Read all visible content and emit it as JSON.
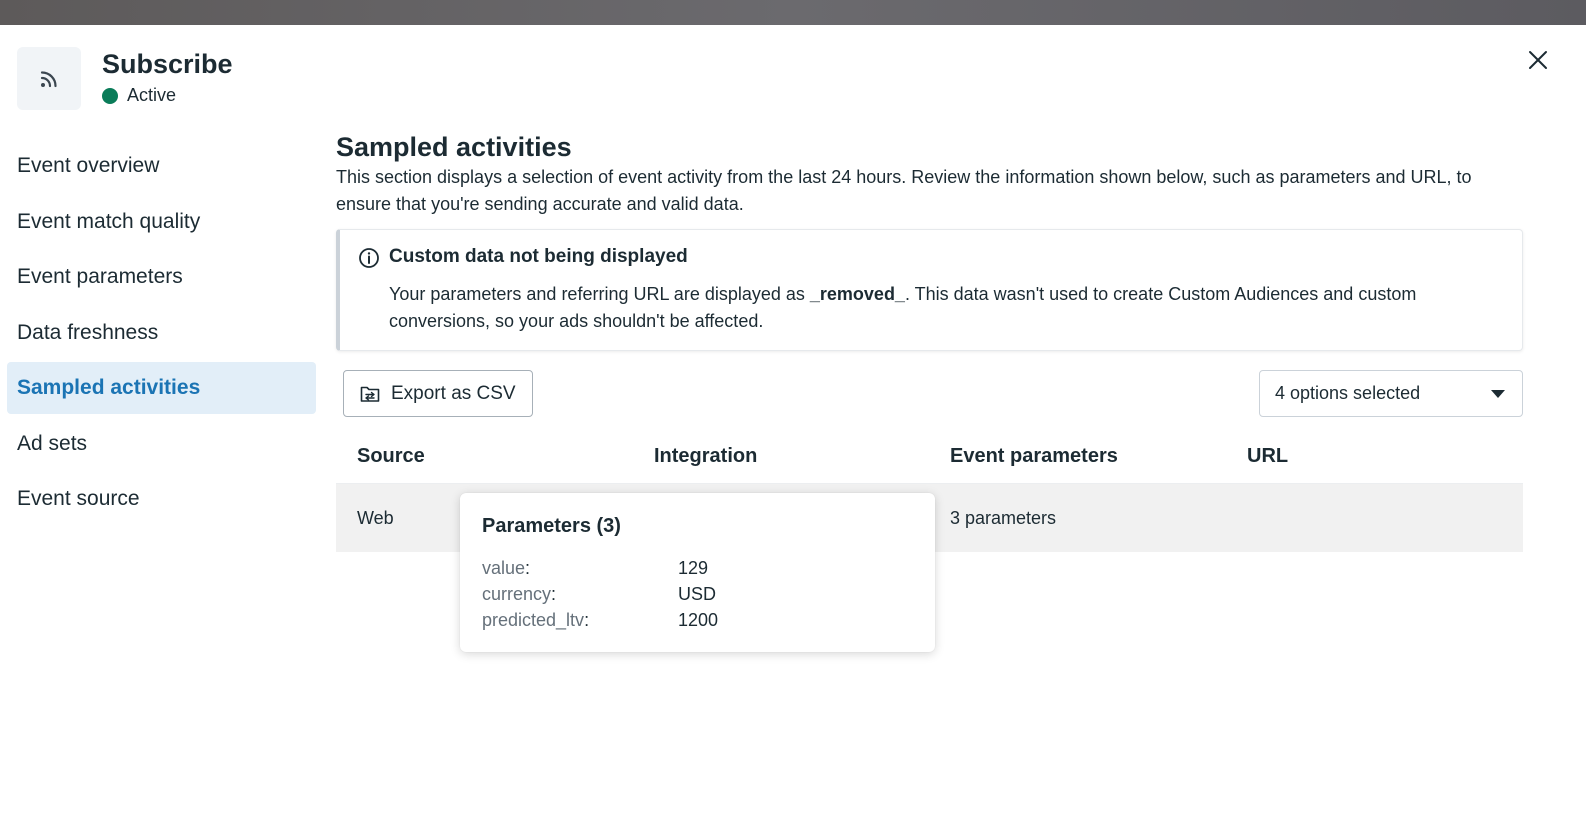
{
  "header": {
    "icon": "rss-feed-icon",
    "title": "Subscribe",
    "status": "Active",
    "status_color": "#0a7c59"
  },
  "sidebar": {
    "items": [
      {
        "label": "Event overview",
        "active": false
      },
      {
        "label": "Event match quality",
        "active": false
      },
      {
        "label": "Event parameters",
        "active": false
      },
      {
        "label": "Data freshness",
        "active": false
      },
      {
        "label": "Sampled activities",
        "active": true
      },
      {
        "label": "Ad sets",
        "active": false
      },
      {
        "label": "Event source",
        "active": false
      }
    ]
  },
  "main": {
    "title": "Sampled activities",
    "description": "This section displays a selection of event activity from the last 24 hours. Review the information shown below, such as parameters and URL, to ensure that you're sending accurate and valid data.",
    "notice": {
      "icon": "info-icon",
      "title": "Custom data not being displayed",
      "text_before": "Your parameters and referring URL are displayed as ",
      "text_bold": "_removed_",
      "text_after": ". This data wasn't used to create Custom Audiences and custom conversions, so your ads shouldn't be affected."
    },
    "export_label": "Export as CSV",
    "filter_label": "4 options selected",
    "table": {
      "columns": [
        "Source",
        "Integration",
        "Event parameters",
        "URL"
      ],
      "rows": [
        {
          "source": "Web",
          "integration": "",
          "event_parameters": "3 parameters",
          "url": ""
        }
      ]
    }
  },
  "tooltip": {
    "title": "Parameters (3)",
    "params": [
      {
        "key": "value",
        "value": "129"
      },
      {
        "key": "currency",
        "value": "USD"
      },
      {
        "key": "predicted_ltv",
        "value": "1200"
      }
    ]
  },
  "colors": {
    "accent": "#1b74b4",
    "active_bg": "#e2eef8",
    "text": "#1c2b33",
    "muted": "#65707a"
  }
}
